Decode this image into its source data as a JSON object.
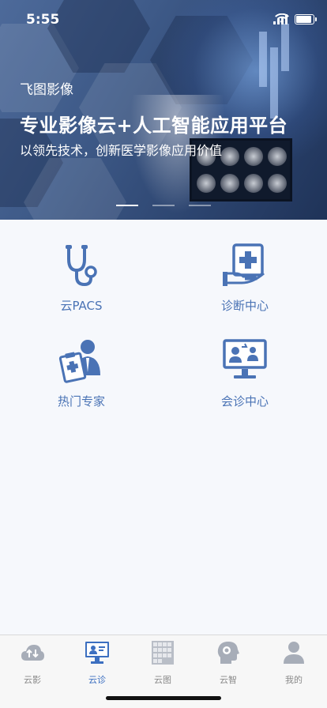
{
  "status": {
    "time": "5:55"
  },
  "banner": {
    "brand": "飞图影像",
    "title": "专业影像云+人工智能应用平台",
    "subtitle": "以领先技术，创新医学影像应用价值",
    "page_count": 3,
    "active_page": 1
  },
  "grid": [
    {
      "label": "云PACS",
      "icon": "stethoscope-icon"
    },
    {
      "label": "诊断中心",
      "icon": "medical-box-icon"
    },
    {
      "label": "热门专家",
      "icon": "doctor-clipboard-icon"
    },
    {
      "label": "会诊中心",
      "icon": "video-consult-icon"
    }
  ],
  "tabs": [
    {
      "label": "云影",
      "icon": "cloud-sync-icon",
      "active": false
    },
    {
      "label": "云诊",
      "icon": "monitor-doctor-icon",
      "active": true
    },
    {
      "label": "云图",
      "icon": "scan-grid-icon",
      "active": false
    },
    {
      "label": "云智",
      "icon": "ai-head-icon",
      "active": false
    },
    {
      "label": "我的",
      "icon": "user-icon",
      "active": false
    }
  ],
  "colors": {
    "accent": "#4a73b5",
    "tab_active": "#3c6fc0",
    "tab_inactive": "#8a8a8a",
    "background": "#f6f8fc"
  }
}
